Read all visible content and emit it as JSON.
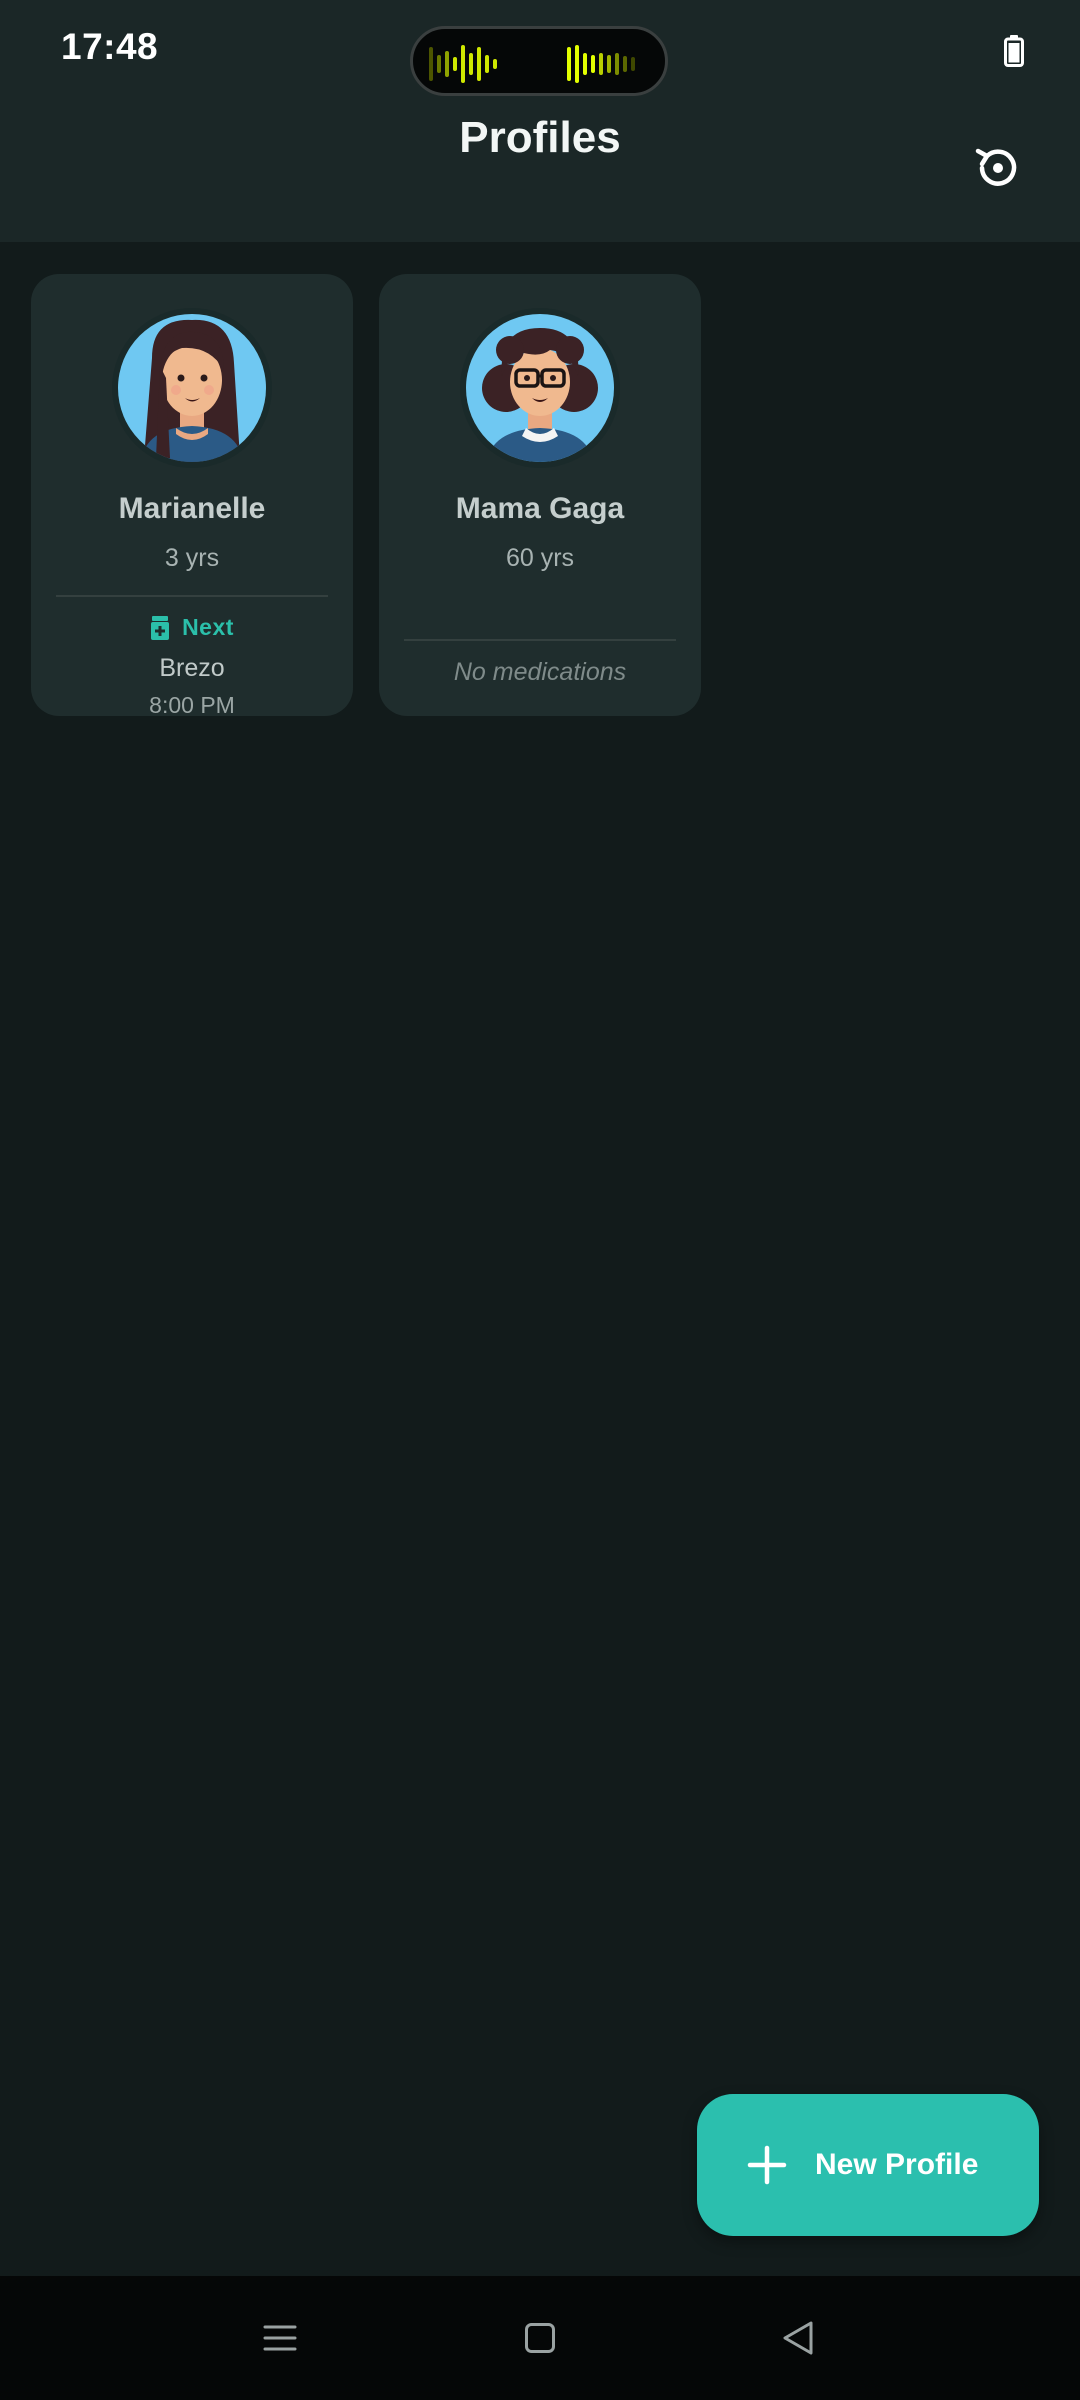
{
  "status_bar": {
    "time": "17:48"
  },
  "header": {
    "title": "Profiles"
  },
  "profiles": [
    {
      "name": "Marianelle",
      "age": "3 yrs",
      "next_label": "Next",
      "medication": "Brezo",
      "time": "8:00 PM"
    },
    {
      "name": "Mama Gaga",
      "age": "60 yrs",
      "empty_text": "No medications"
    }
  ],
  "fab": {
    "label": "New Profile"
  },
  "colors": {
    "accent": "#2bbfae",
    "background": "#121b1b",
    "card": "#1f2d2d",
    "header": "#1b2727"
  },
  "icons": {
    "restore": "restore-icon",
    "battery": "battery-icon",
    "medication": "pill-bottle-icon",
    "add": "plus-icon",
    "nav_menu": "menu-icon",
    "nav_home": "home-icon",
    "nav_back": "back-icon"
  }
}
